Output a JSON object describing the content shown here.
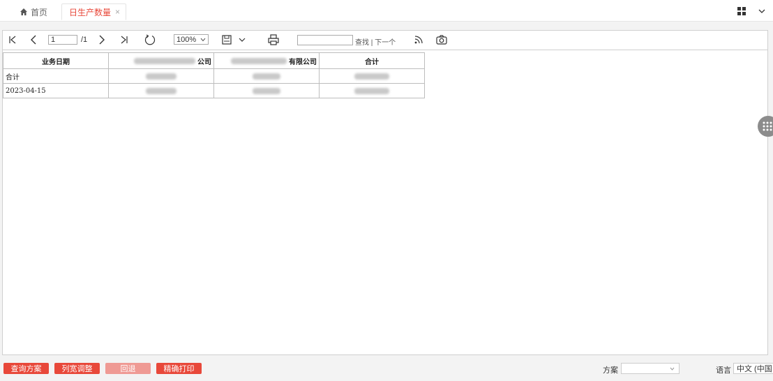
{
  "tabs": {
    "home_label": "首页",
    "active_label": "日生产数量",
    "close_glyph": "×"
  },
  "toolbar": {
    "page_value": "1",
    "page_total": "/1",
    "zoom_value": "100%",
    "find_placeholder": "",
    "find_link": "查找 | 下一个"
  },
  "table": {
    "headers": [
      "业务日期",
      "公司",
      "有限公司",
      "合计"
    ],
    "rows": [
      {
        "label": "合计"
      },
      {
        "label": "2023-04-15"
      }
    ]
  },
  "bottom": {
    "buttons": [
      "查询方案",
      "列宽调整",
      "回退",
      "精确打印"
    ],
    "scheme_label": "方案",
    "scheme_value": "",
    "language_label": "语言",
    "language_value": "中文 (中国"
  },
  "colors": {
    "accent": "#e8483a",
    "accent_disabled": "#ef9a94"
  }
}
